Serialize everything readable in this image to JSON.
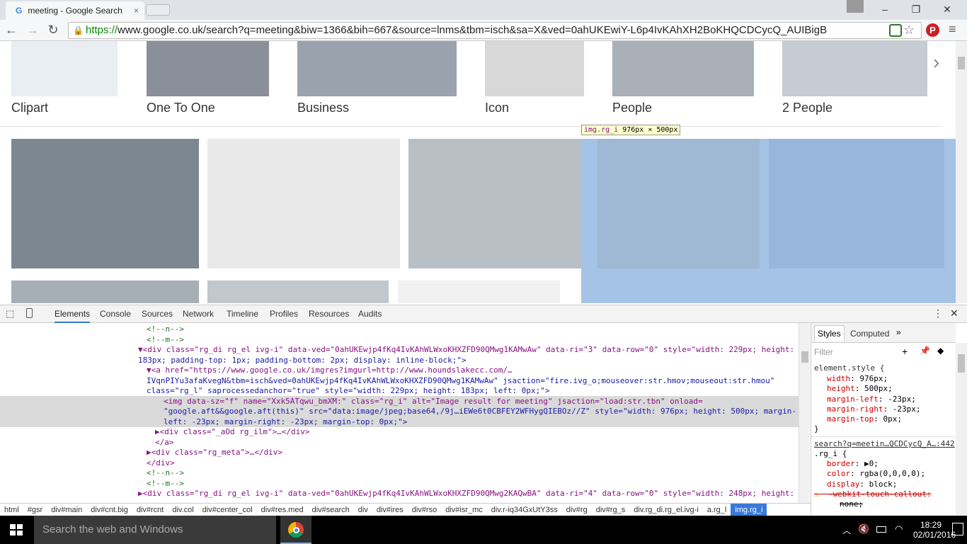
{
  "browser": {
    "tab_title": "meeting - Google Search",
    "url_scheme": "https://",
    "url_rest": "www.google.co.uk/search?q=meeting&biw=1366&bih=667&source=lnms&tbm=isch&sa=X&ved=0ahUKEwiY-L6p4IvKAhXH2BoKHQCDCycQ_AUIBigB"
  },
  "categories": [
    "Clipart",
    "One To One",
    "Business",
    "Icon",
    "People",
    "2 People"
  ],
  "tooltip": {
    "selector": "img.rg_i",
    "size": "976px × 500px"
  },
  "devtools": {
    "tabs": [
      "Elements",
      "Console",
      "Sources",
      "Network",
      "Timeline",
      "Profiles",
      "Resources",
      "Audits"
    ],
    "active_tab": "Elements",
    "styles_tabs": [
      "Styles",
      "Computed"
    ],
    "filter_placeholder": "Filter",
    "element_style_header": "element.style {",
    "element_style": [
      {
        "prop": "width",
        "val": "976px;"
      },
      {
        "prop": "height",
        "val": "500px;"
      },
      {
        "prop": "margin-left",
        "val": "-23px;"
      },
      {
        "prop": "margin-right",
        "val": "-23px;"
      },
      {
        "prop": "margin-top",
        "val": "0px;"
      }
    ],
    "rule_source": "search?q=meetin…QCDCycQ_A…:442",
    "rule_selector": ".rg_i {",
    "rule_props": [
      {
        "prop": "border",
        "val": "▶0;"
      },
      {
        "prop": "color",
        "val": "rgba(0,0,0,0);"
      },
      {
        "prop": "display",
        "val": "block;"
      }
    ],
    "struck_prop": "-webkit-touch-callout:",
    "struck_val": "none;",
    "breadcrumbs": [
      "html",
      "#gsr",
      "div#main",
      "div#cnt.big",
      "div#rcnt",
      "div.col",
      "div#center_col",
      "div#res.med",
      "div#search",
      "div",
      "div#ires",
      "div#rso",
      "div#isr_mc",
      "div.r-iq34GxUtY3ss",
      "div#rg",
      "div#rg_s",
      "div.rg_di.rg_el.ivg-i",
      "a.rg_l",
      "img.rg_i"
    ],
    "dom_lines": [
      "<!--n-->",
      "<!--m-->",
      "▼<div class=\"rg_di rg_el ivg-i\" data-ved=\"0ahUKEwjp4fKq4IvKAhWLWxoKHXZFD90QMwg1KAMwAw\" data-ri=\"3\" data-row=\"0\" style=\"width: 229px; height:",
      "183px; padding-top: 1px; padding-bottom: 2px; display: inline-block;\">",
      "▼<a href=\"https://www.google.co.uk/imgres?imgurl=http://www.houndslakecc.com/…",
      "IVqnPIYu3afaKvegN&tbm=isch&ved=0ahUKEwjp4fKq4IvKAhWLWxoKHXZFD90QMwg1KAMwAw\" jsaction=\"fire.ivg_o;mouseover:str.hmov;mouseout:str.hmou\"",
      "class=\"rg_l\" saprocessedanchor=\"true\" style=\"width: 229px; height: 183px; left: 0px;\">",
      "<img data-sz=\"f\" name=\"Xxk5ATqwu_bmXM:\" class=\"rg_i\" alt=\"Image result for meeting\" jsaction=\"load:str.tbn\" onload=",
      "\"google.aft&&google.aft(this)\" src=\"data:image/jpeg;base64,/9j…iEWe6t0CBFEY2WFHygQIEBOz//Z\" style=\"width: 976px; height: 500px; margin-",
      "left: -23px; margin-right: -23px; margin-top: 0px;\">",
      "▶<div class=\"_aOd rg_ilm\">…</div>",
      "</a>",
      "▶<div class=\"rg_meta\">…</div>",
      "</div>",
      "<!--n-->",
      "<!--m-->",
      "▶<div class=\"rg_di rg_el ivg-i\" data-ved=\"0ahUKEwjp4fKq4IvKAhWLWxoKHXZFD90QMwg2KAQwBA\" data-ri=\"4\" data-row=\"0\" style=\"width: 248px; height:"
    ]
  },
  "taskbar": {
    "search_placeholder": "Search the web and Windows",
    "time": "18:29",
    "date": "02/01/2016"
  }
}
